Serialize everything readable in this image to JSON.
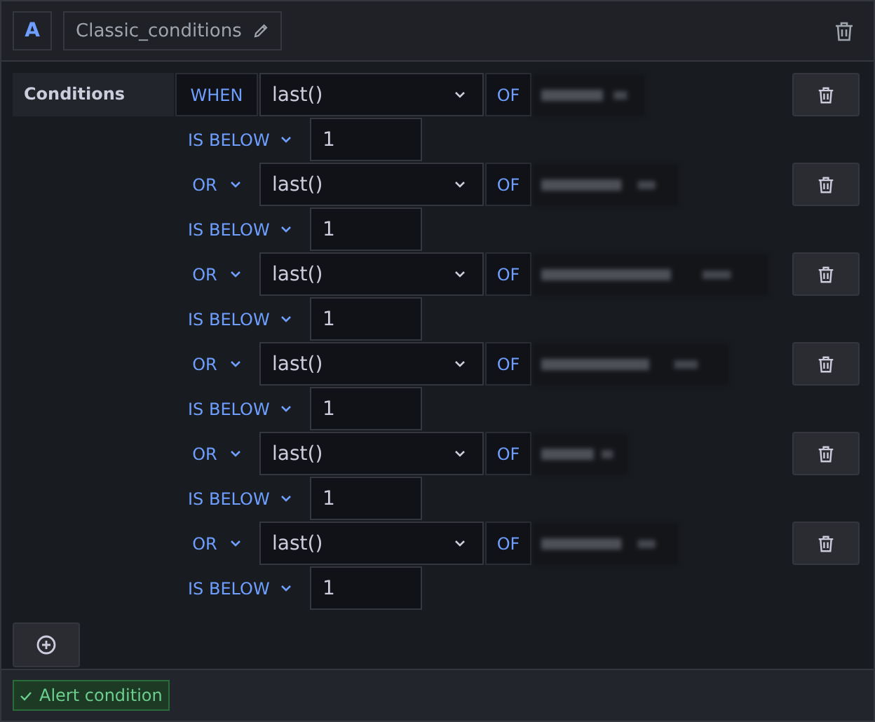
{
  "query": {
    "ref_id": "A",
    "name": "Classic_conditions"
  },
  "section_label": "Conditions",
  "conditions": [
    {
      "operator": {
        "text": "WHEN",
        "kind": "static"
      },
      "reducer": "last()",
      "of": "OF",
      "evaluator": "IS BELOW",
      "threshold": "1"
    },
    {
      "operator": {
        "text": "OR",
        "kind": "dropdown"
      },
      "reducer": "last()",
      "of": "OF",
      "evaluator": "IS BELOW",
      "threshold": "1"
    },
    {
      "operator": {
        "text": "OR",
        "kind": "dropdown"
      },
      "reducer": "last()",
      "of": "OF",
      "evaluator": "IS BELOW",
      "threshold": "1"
    },
    {
      "operator": {
        "text": "OR",
        "kind": "dropdown"
      },
      "reducer": "last()",
      "of": "OF",
      "evaluator": "IS BELOW",
      "threshold": "1"
    },
    {
      "operator": {
        "text": "OR",
        "kind": "dropdown"
      },
      "reducer": "last()",
      "of": "OF",
      "evaluator": "IS BELOW",
      "threshold": "1"
    },
    {
      "operator": {
        "text": "OR",
        "kind": "dropdown"
      },
      "reducer": "last()",
      "of": "OF",
      "evaluator": "IS BELOW",
      "threshold": "1"
    }
  ],
  "footer": {
    "badge": "Alert condition",
    "checked": true
  }
}
